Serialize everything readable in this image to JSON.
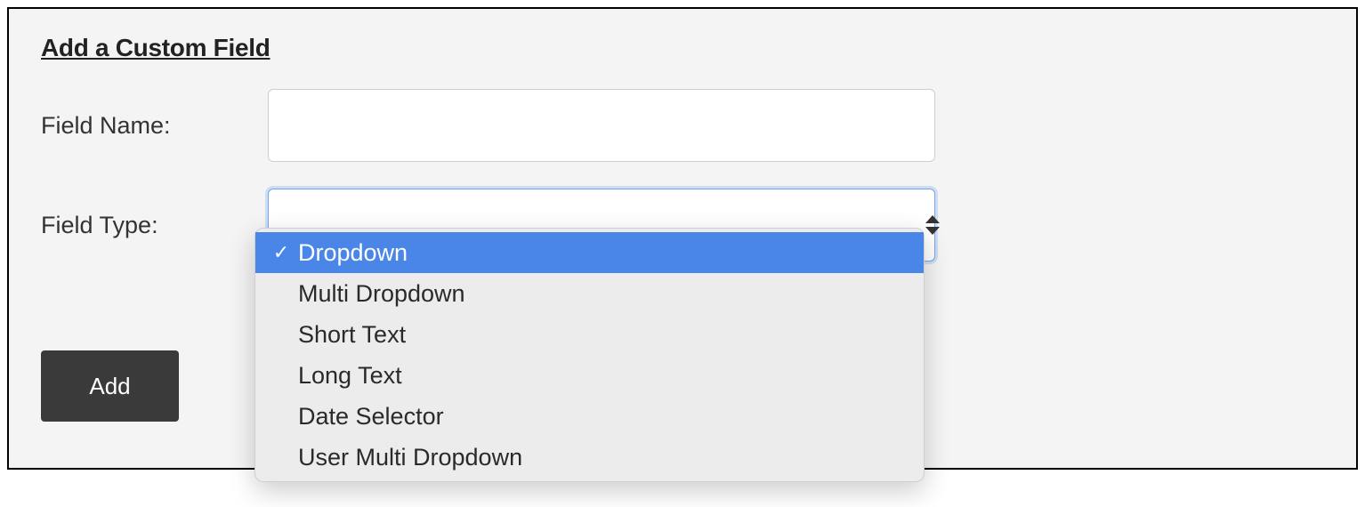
{
  "heading": "Add a Custom Field",
  "form": {
    "field_name_label": "Field Name:",
    "field_name_value": "",
    "field_type_label": "Field Type:",
    "field_type_selected": "Dropdown",
    "field_type_options": {
      "o0": "Dropdown",
      "o1": "Multi Dropdown",
      "o2": "Short Text",
      "o3": "Long Text",
      "o4": "Date Selector",
      "o5": "User Multi Dropdown"
    }
  },
  "buttons": {
    "add_label": "Add"
  },
  "check_glyph": "✓"
}
